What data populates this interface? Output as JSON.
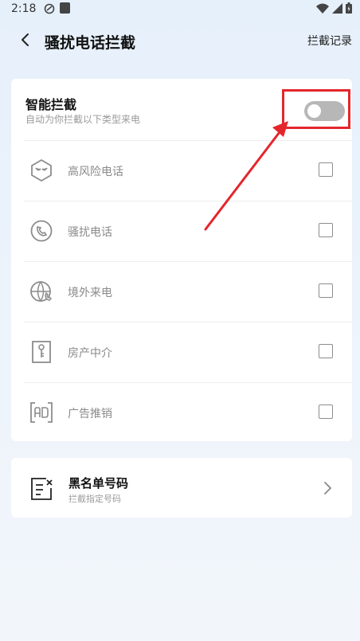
{
  "status_bar": {
    "time": "2:18"
  },
  "header": {
    "title": "骚扰电话拦截",
    "records_label": "拦截记录"
  },
  "smart_block": {
    "title": "智能拦截",
    "subtitle": "自动为你拦截以下类型来电",
    "enabled": false
  },
  "categories": [
    {
      "label": "高风险电话",
      "icon": "mask-icon",
      "checked": false
    },
    {
      "label": "骚扰电话",
      "icon": "phone-circle-icon",
      "checked": false
    },
    {
      "label": "境外来电",
      "icon": "globe-phone-icon",
      "checked": false
    },
    {
      "label": "房产中介",
      "icon": "key-door-icon",
      "checked": false
    },
    {
      "label": "广告推销",
      "icon": "ad-bracket-icon",
      "checked": false
    }
  ],
  "blacklist": {
    "title": "黑名单号码",
    "subtitle": "拦截指定号码",
    "icon": "blacklist-icon"
  },
  "accent_colors": {
    "annotation": "#e4262c",
    "toggle_off": "#b7b7b7"
  }
}
